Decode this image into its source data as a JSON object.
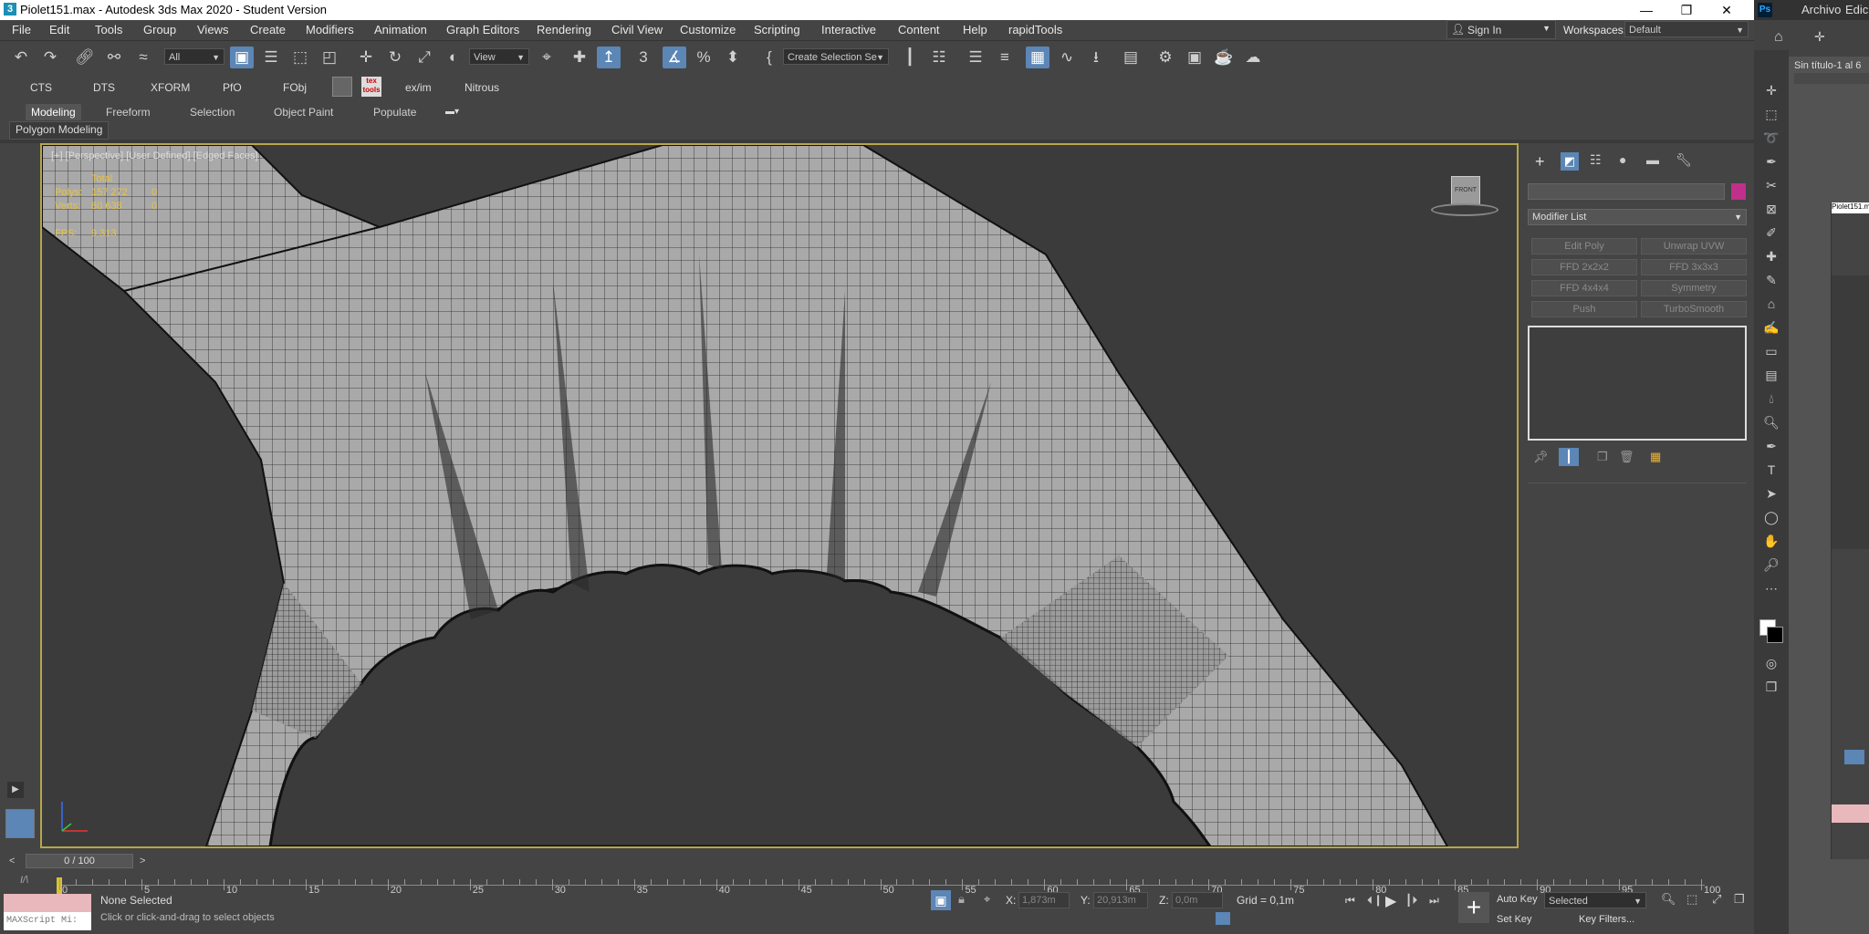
{
  "window": {
    "title": "Piolet151.max - Autodesk 3ds Max 2020 - Student Version",
    "app_icon": "3"
  },
  "menu": [
    "File",
    "Edit",
    "Tools",
    "Group",
    "Views",
    "Create",
    "Modifiers",
    "Animation",
    "Graph Editors",
    "Rendering",
    "Civil View",
    "Customize",
    "Scripting",
    "Interactive",
    "Content",
    "Help",
    "rapidTools"
  ],
  "account": {
    "sign_in": "Sign In",
    "workspaces_label": "Workspaces:",
    "workspace_value": "Default"
  },
  "toolbar": {
    "selection_filter": "All",
    "reference_coord": "View",
    "named_selection": "Create Selection Se",
    "snap_3": "3"
  },
  "toolbar2": [
    "CTS",
    "DTS",
    "XFORM",
    "PfO",
    "FObj",
    "ex/im",
    "Nitrous"
  ],
  "ribbon": {
    "tabs": [
      "Modeling",
      "Freeform",
      "Selection",
      "Object Paint",
      "Populate"
    ],
    "sub_label": "Polygon Modeling"
  },
  "viewport": {
    "label": "[+] [Perspective] [User Defined] [Edged Faces]",
    "stats": {
      "header": "Total",
      "polys_label": "Polys:",
      "polys_value": "157 272",
      "polys_sel": "0",
      "verts_label": "Verts:",
      "verts_value": "80 638",
      "verts_sel": "0",
      "fps_label": "FPS:",
      "fps_value": "9.313"
    },
    "viewcube_label": "FRONT"
  },
  "command_panel": {
    "modifier_list": "Modifier List",
    "buttons": [
      "Edit Poly",
      "Unwrap UVW",
      "FFD 2x2x2",
      "FFD 3x3x3",
      "FFD 4x4x4",
      "Symmetry",
      "Push",
      "TurboSmooth"
    ],
    "color_swatch": "#c0308a"
  },
  "time": {
    "frame": "0 / 100",
    "ticks": [
      "0",
      "5",
      "10",
      "15",
      "20",
      "25",
      "30",
      "35",
      "40",
      "45",
      "50",
      "55",
      "60",
      "65",
      "70",
      "75",
      "80",
      "85",
      "90",
      "95",
      "100"
    ]
  },
  "status": {
    "maxscript": "MAXScript Mi:",
    "selection": "None Selected",
    "prompt": "Click or click-and-drag to select objects",
    "x_label": "X:",
    "x_value": "1,873m",
    "y_label": "Y:",
    "y_value": "20,913m",
    "z_label": "Z:",
    "z_value": "0,0m",
    "grid": "Grid = 0,1m",
    "auto_key": "Auto Key",
    "set_key": "Set Key",
    "selected_combo": "Selected",
    "key_filters": "Key Filters..."
  },
  "photoshop": {
    "menu": [
      "Archivo",
      "Edición"
    ],
    "doc_tab": "Sin título-1 al 6",
    "mini_title": "Piolet151.m",
    "ps_logo": "Ps"
  },
  "colors": {
    "accent": "#5b86b6",
    "viewport_border": "#b7a64b",
    "stats": "#e6c34b"
  }
}
